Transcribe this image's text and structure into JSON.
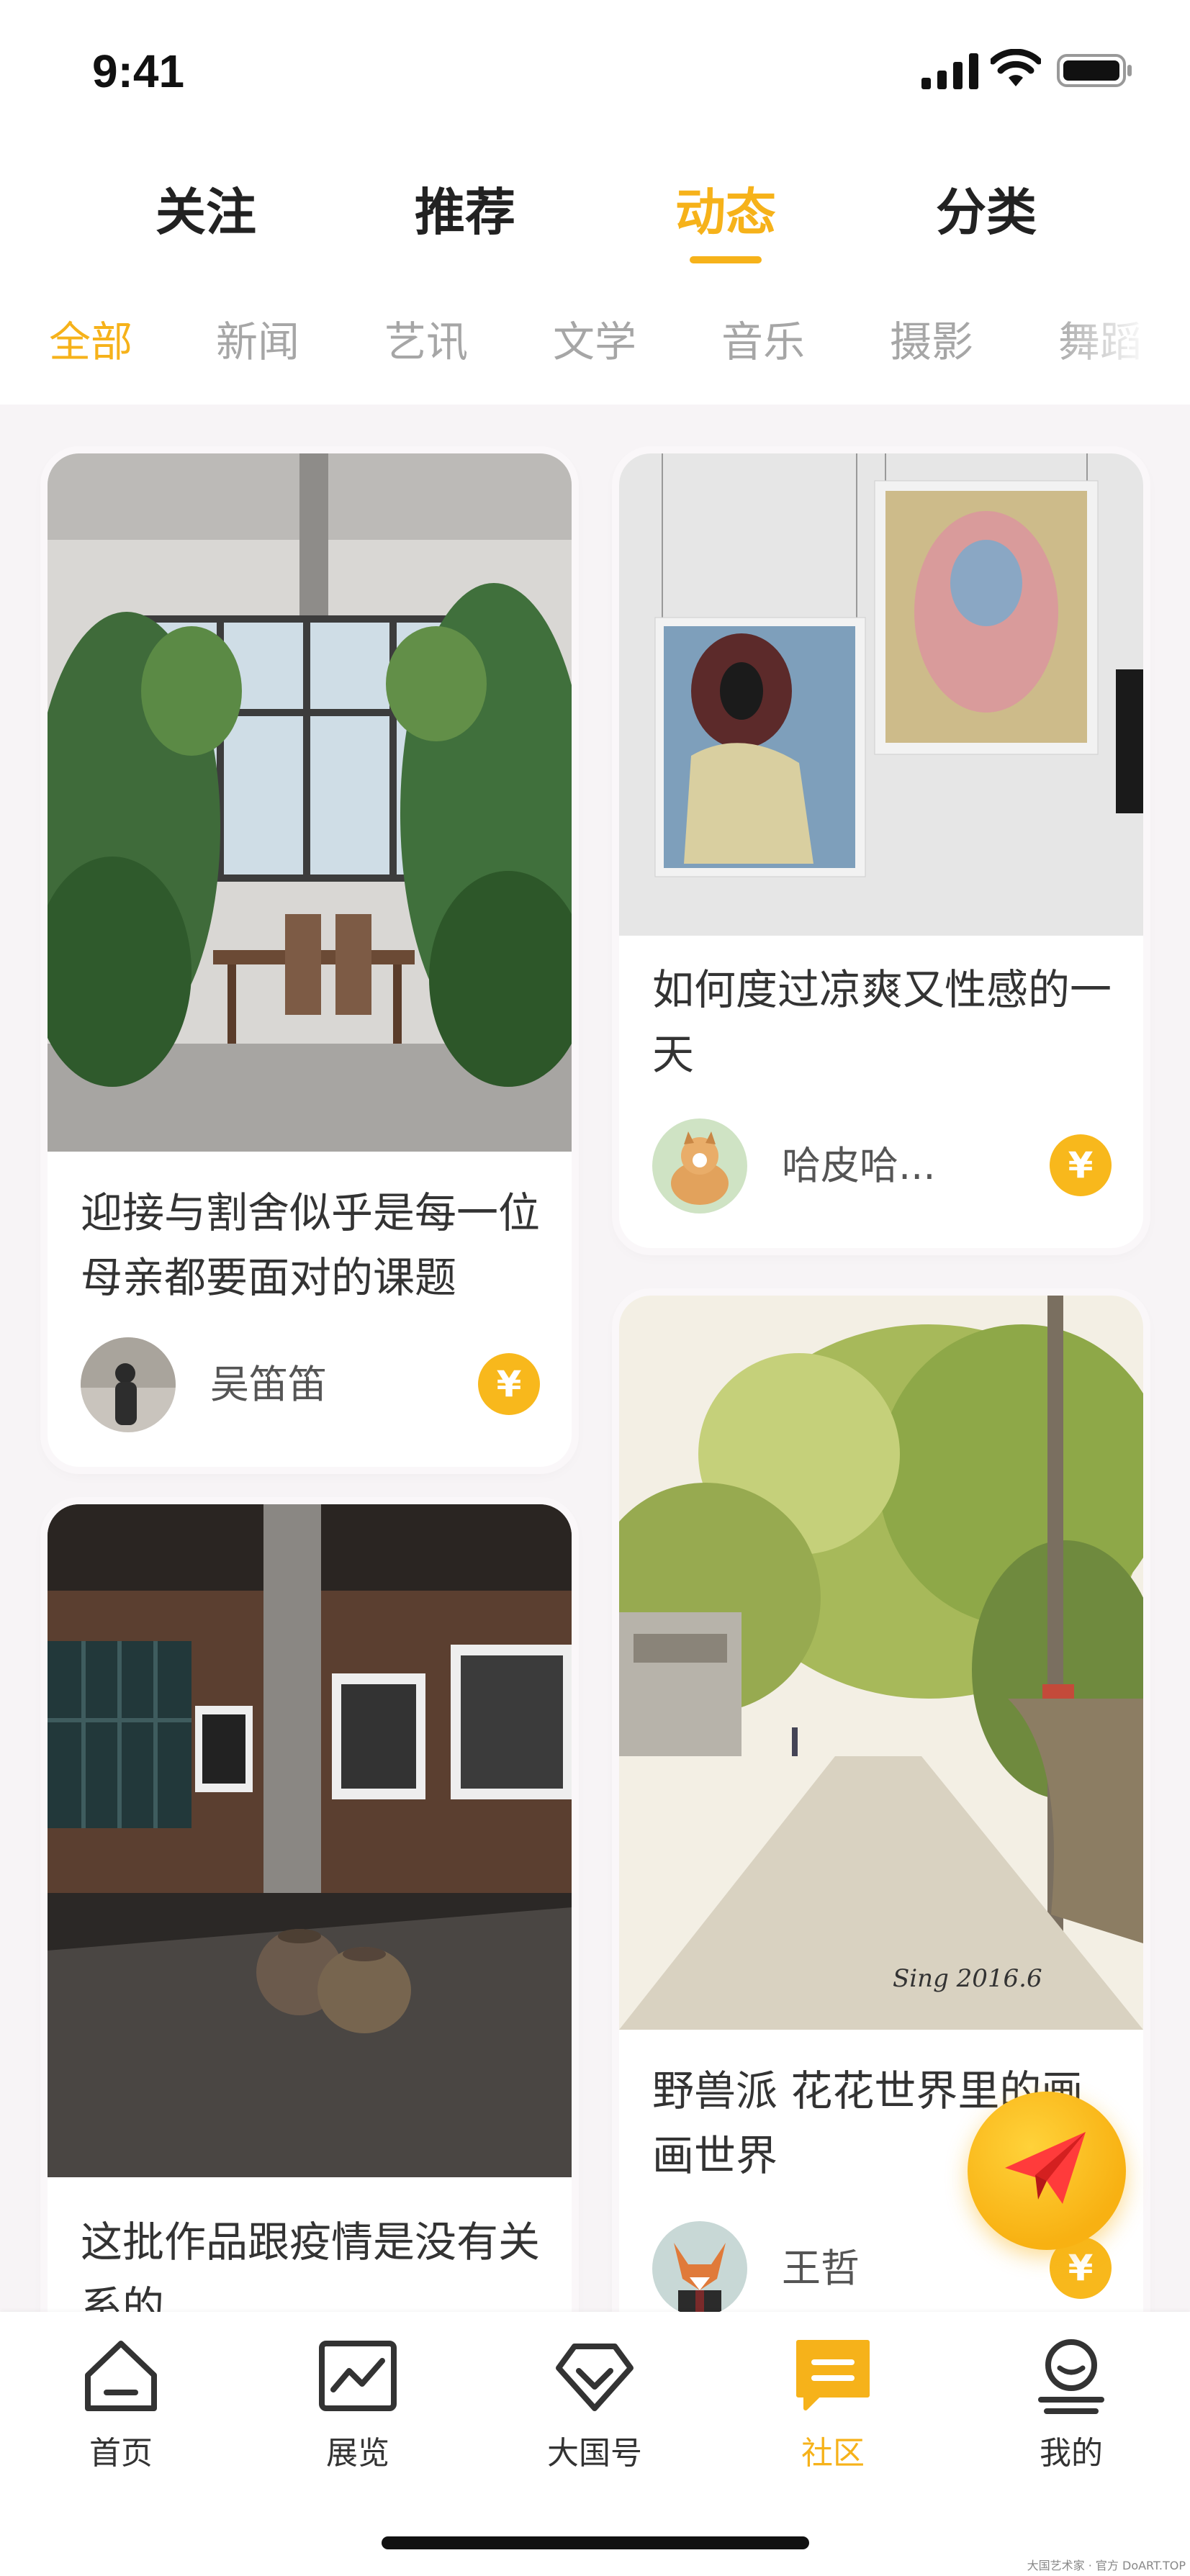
{
  "status_bar": {
    "time": "9:41"
  },
  "main_tabs": [
    {
      "label": "关注",
      "active": false
    },
    {
      "label": "推荐",
      "active": false
    },
    {
      "label": "动态",
      "active": true
    },
    {
      "label": "分类",
      "active": false
    }
  ],
  "category_tabs": [
    {
      "label": "全部",
      "active": true
    },
    {
      "label": "新闻",
      "active": false
    },
    {
      "label": "艺讯",
      "active": false
    },
    {
      "label": "文学",
      "active": false
    },
    {
      "label": "音乐",
      "active": false
    },
    {
      "label": "摄影",
      "active": false
    },
    {
      "label": "舞蹈",
      "active": false
    }
  ],
  "feed": {
    "cards": [
      {
        "title": "迎接与割舍似乎是每一位母亲都要面对的课题",
        "author": "吴笛笛",
        "coin": "¥"
      },
      {
        "title": "如何度过凉爽又性感的一天",
        "author": "哈皮哈...",
        "coin": "¥"
      },
      {
        "title": "这批作品跟疫情是没有关系的",
        "author": "",
        "coin": ""
      },
      {
        "title": "野兽派 花花世界里的画画世界",
        "author": "王哲",
        "coin": "¥"
      }
    ]
  },
  "bottom_nav": [
    {
      "label": "首页",
      "icon": "home-icon",
      "active": false
    },
    {
      "label": "展览",
      "icon": "exhibition-icon",
      "active": false
    },
    {
      "label": "大国号",
      "icon": "daguohao-icon",
      "active": false
    },
    {
      "label": "社区",
      "icon": "community-icon",
      "active": true
    },
    {
      "label": "我的",
      "icon": "profile-icon",
      "active": false
    }
  ],
  "watermark": "大国艺术家 · 官方 DoART.TOP",
  "colors": {
    "accent": "#f6b21a",
    "coin": "#f8b81c",
    "background": "#f7f4f6"
  }
}
